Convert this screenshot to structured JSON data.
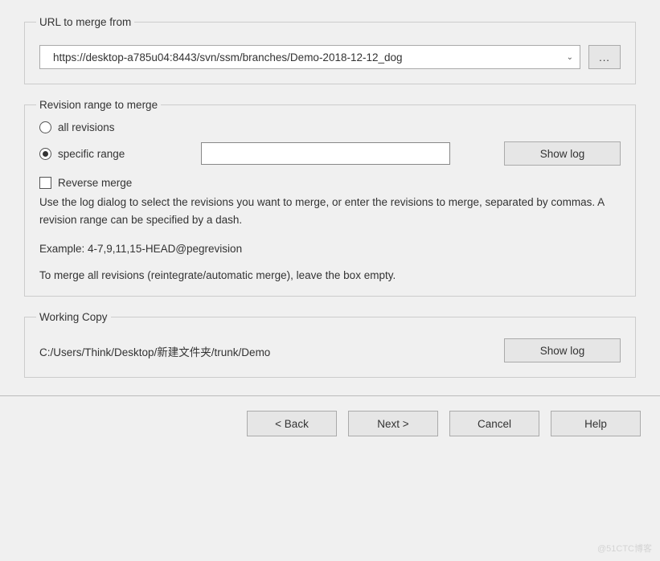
{
  "url_group": {
    "legend": "URL to merge from",
    "url_value": "https://desktop-a785u04:8443/svn/ssm/branches/Demo-2018-12-12_dog",
    "browse_label": "..."
  },
  "revision_group": {
    "legend": "Revision range to merge",
    "all_label": "all revisions",
    "specific_label": "specific range",
    "range_value": "",
    "showlog_label": "Show log",
    "reverse_label": "Reverse merge",
    "help_line": "Use the log dialog to select the revisions you want to merge, or enter the revisions to merge, separated by commas. A revision range can be specified by a dash.",
    "example_line": "Example: 4-7,9,11,15-HEAD@pegrevision",
    "final_line": "To merge all revisions (reintegrate/automatic merge), leave the box empty."
  },
  "wc_group": {
    "legend": "Working Copy",
    "path": "C:/Users/Think/Desktop/新建文件夹/trunk/Demo",
    "showlog_label": "Show log"
  },
  "buttons": {
    "back": "< Back",
    "next": "Next >",
    "cancel": "Cancel",
    "help": "Help"
  },
  "watermark": "@51CTC博客"
}
